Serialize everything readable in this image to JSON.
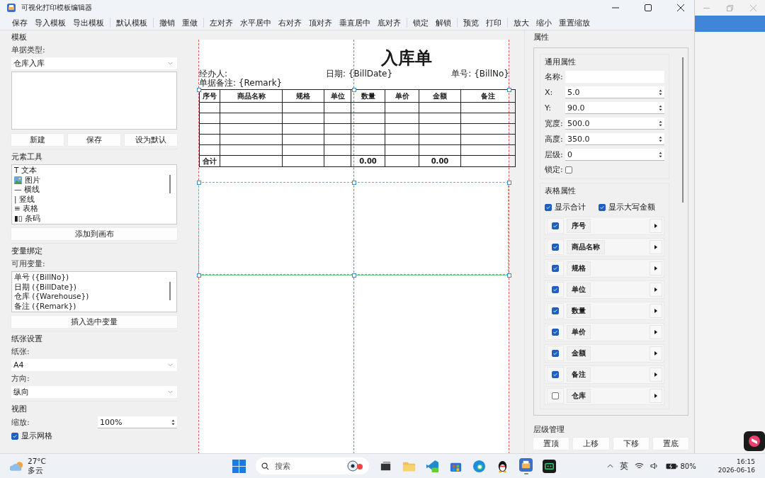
{
  "window": {
    "title": "可视化打印模板编辑器"
  },
  "toolbar": [
    [
      "保存",
      "导入模板",
      "导出模板"
    ],
    [
      "默认模板"
    ],
    [
      "撤销",
      "重做"
    ],
    [
      "左对齐",
      "水平居中",
      "右对齐",
      "顶对齐",
      "垂直居中",
      "底对齐"
    ],
    [
      "锁定",
      "解锁"
    ],
    [
      "预览",
      "打印"
    ],
    [
      "放大",
      "缩小",
      "重置缩放"
    ]
  ],
  "template": {
    "title": "模板",
    "type_label": "单据类型:",
    "type_value": "仓库入库",
    "buttons": [
      "新建",
      "保存",
      "设为默认"
    ]
  },
  "element_tools": {
    "title": "元素工具",
    "items": [
      {
        "kind": "glyph",
        "glyph": "T",
        "label": "文本"
      },
      {
        "kind": "image",
        "label": "图片"
      },
      {
        "kind": "glyph",
        "glyph": "—",
        "label": "横线"
      },
      {
        "kind": "glyph",
        "glyph": "|",
        "label": "竖线"
      },
      {
        "kind": "glyph",
        "glyph": "≡",
        "label": "表格"
      },
      {
        "kind": "glyph",
        "glyph": "▮▯",
        "label": "条码"
      }
    ],
    "button": "添加到画布"
  },
  "variables": {
    "title": "变量绑定",
    "label": "可用变量:",
    "items": [
      "单号 ({BillNo})",
      "日期 ({BillDate})",
      "仓库 ({Warehouse})",
      "备注 ({Remark})"
    ],
    "button": "插入选中变量"
  },
  "paper": {
    "title": "纸张设置",
    "paper_label": "纸张:",
    "paper_value": "A4",
    "orientation_label": "方向:",
    "orientation_value": "纵向"
  },
  "view": {
    "title": "视图",
    "zoom_label": "缩放:",
    "zoom_value": "100%",
    "grid": {
      "label": "显示网格",
      "checked": true
    }
  },
  "canvas": {
    "title": "入库单",
    "handler": "经办人:",
    "date": "日期: {BillDate}",
    "number": "单号: {BillNo}",
    "remark": "单据备注: {Remark}",
    "columns": [
      "序号",
      "商品名称",
      "规格",
      "单位",
      "数量",
      "单价",
      "金额",
      "备注"
    ],
    "blank_rows": [
      {
        "kind": "blank"
      },
      {
        "kind": "blank"
      },
      {
        "kind": "blank"
      },
      {
        "kind": "blank"
      },
      {
        "kind": "blank"
      }
    ],
    "total_row": [
      {
        "kind": "text",
        "text": "合计"
      },
      {
        "kind": "empty"
      },
      {
        "kind": "empty"
      },
      {
        "kind": "empty"
      },
      {
        "kind": "text",
        "text": "0.00"
      },
      {
        "kind": "empty"
      },
      {
        "kind": "text",
        "text": "0.00"
      },
      {
        "kind": "empty"
      }
    ]
  },
  "properties": {
    "title": "属性",
    "general": {
      "title": "通用属性",
      "fields": [
        {
          "kind": "text",
          "label": "名称:"
        },
        {
          "kind": "spin",
          "label": "X:",
          "value": "5.0"
        },
        {
          "kind": "spin",
          "label": "Y:",
          "value": "90.0"
        },
        {
          "kind": "spin",
          "label": "宽度:",
          "value": "500.0"
        },
        {
          "kind": "spin",
          "label": "高度:",
          "value": "350.0"
        },
        {
          "kind": "spin",
          "label": "层级:",
          "value": "0"
        }
      ],
      "lock": {
        "label": "锁定:",
        "checked": false
      }
    },
    "table": {
      "title": "表格属性",
      "options": [
        {
          "label": "显示合计",
          "checked": true
        },
        {
          "label": "显示大写金额",
          "checked": true
        }
      ],
      "columns": [
        {
          "label": "序号",
          "checked": true
        },
        {
          "label": "商品名称",
          "checked": true
        },
        {
          "label": "规格",
          "checked": true
        },
        {
          "label": "单位",
          "checked": true
        },
        {
          "label": "数量",
          "checked": true
        },
        {
          "label": "单价",
          "checked": true
        },
        {
          "label": "金额",
          "checked": true
        },
        {
          "label": "备注",
          "checked": true
        },
        {
          "label": "仓库",
          "checked": false
        }
      ]
    },
    "layer": {
      "title": "层级管理",
      "buttons": [
        "置顶",
        "上移",
        "下移",
        "置底"
      ]
    }
  },
  "taskbar": {
    "temperature": "27°C",
    "weather": "多云",
    "search_placeholder": "搜索",
    "ime": "英",
    "battery": "80%",
    "time": "16:15",
    "date": "2026-06-16"
  }
}
